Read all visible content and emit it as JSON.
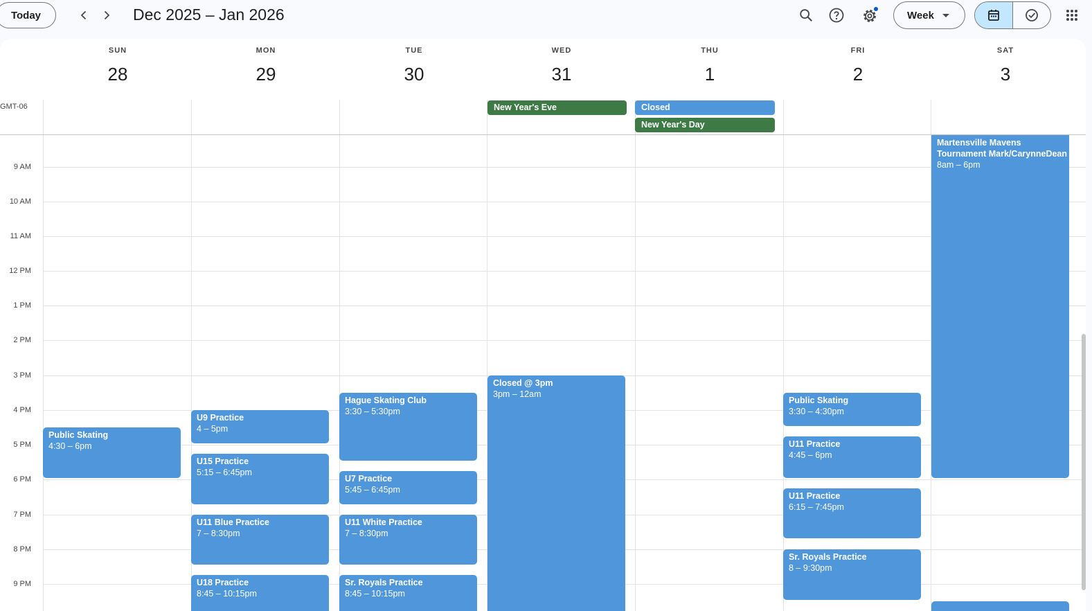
{
  "toolbar": {
    "today_label": "Today",
    "date_range": "Dec 2025 – Jan 2026",
    "view_label": "Week",
    "prev_icon": "chevron-left-icon",
    "next_icon": "chevron-right-icon"
  },
  "timezone": "GMT-06",
  "days": [
    {
      "name": "SUN",
      "num": "28"
    },
    {
      "name": "MON",
      "num": "29"
    },
    {
      "name": "TUE",
      "num": "30"
    },
    {
      "name": "WED",
      "num": "31"
    },
    {
      "name": "THU",
      "num": "1"
    },
    {
      "name": "FRI",
      "num": "2"
    },
    {
      "name": "SAT",
      "num": "3"
    }
  ],
  "hours": [
    "9 AM",
    "10 AM",
    "11 AM",
    "12 PM",
    "1 PM",
    "2 PM",
    "3 PM",
    "4 PM",
    "5 PM",
    "6 PM",
    "7 PM",
    "8 PM",
    "9 PM"
  ],
  "colors": {
    "event_blue": "#4f96db",
    "holiday_green": "#3d7a46",
    "accent": "#c2e7ff"
  },
  "allday": {
    "wed_holiday": "New Year's Eve",
    "thu_closed": "Closed",
    "thu_holiday": "New Year's Day"
  },
  "events": {
    "sun_public": {
      "title": "Public Skating",
      "time": "4:30 – 6pm"
    },
    "mon_u9": {
      "title": "U9 Practice",
      "time": "4 – 5pm"
    },
    "mon_u15": {
      "title": "U15 Practice",
      "time": "5:15 – 6:45pm"
    },
    "mon_u11blue": {
      "title": "U11 Blue Practice",
      "time": "7 – 8:30pm"
    },
    "mon_u18": {
      "title": "U18 Practice",
      "time": "8:45 – 10:15pm"
    },
    "tue_hague": {
      "title": "Hague Skating Club",
      "time": "3:30 – 5:30pm"
    },
    "tue_u7": {
      "title": "U7 Practice",
      "time": "5:45 – 6:45pm"
    },
    "tue_u11white": {
      "title": "U11 White Practice",
      "time": "7 – 8:30pm"
    },
    "tue_royals": {
      "title": "Sr. Royals Practice",
      "time": "8:45 – 10:15pm"
    },
    "wed_closed": {
      "title": "Closed @ 3pm",
      "time": "3pm – 12am"
    },
    "fri_public": {
      "title": "Public Skating",
      "time": "3:30 – 4:30pm"
    },
    "fri_u11a": {
      "title": "U11 Practice",
      "time": "4:45 – 6pm"
    },
    "fri_u11b": {
      "title": "U11 Practice",
      "time": "6:15 – 7:45pm"
    },
    "fri_royals": {
      "title": "Sr. Royals Practice",
      "time": "8 – 9:30pm"
    },
    "sat_mavens": {
      "title_line1": "Martensville Mavens",
      "title_line2": "Tournament Mark/CarynneDean",
      "time": "8am – 6pm"
    }
  }
}
